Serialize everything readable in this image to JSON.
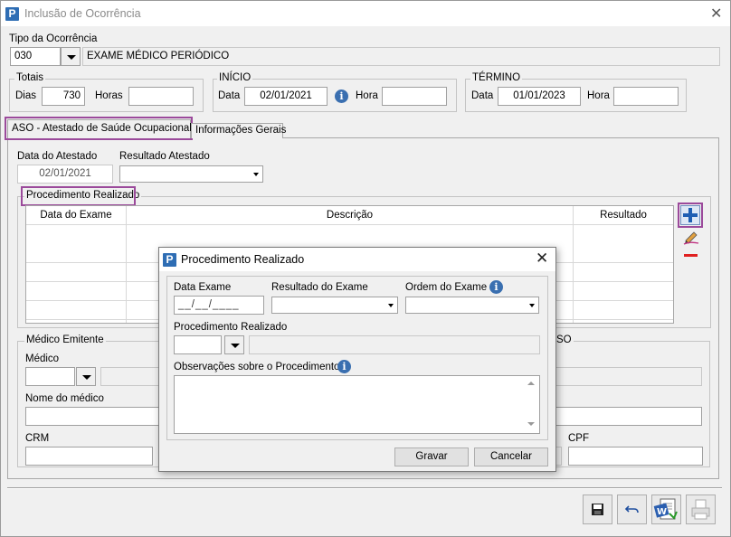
{
  "window": {
    "title": "Inclusão de Ocorrência"
  },
  "tipo": {
    "label": "Tipo da Ocorrência",
    "code": "030",
    "description": "EXAME MÉDICO PERIÓDICO"
  },
  "totais": {
    "title": "Totais",
    "dias_label": "Dias",
    "dias_value": "730",
    "horas_label": "Horas",
    "horas_value": ""
  },
  "inicio": {
    "title": "INÍCIO",
    "data_label": "Data",
    "data_value": "02/01/2021",
    "hora_label": "Hora",
    "hora_value": ""
  },
  "termino": {
    "title": "TÉRMINO",
    "data_label": "Data",
    "data_value": "01/01/2023",
    "hora_label": "Hora",
    "hora_value": ""
  },
  "tabs": [
    {
      "label": "ASO - Atestado de Saúde Ocupacional",
      "active": true
    },
    {
      "label": "Informações Gerais",
      "active": false
    }
  ],
  "aso": {
    "data_atestado_label": "Data do Atestado",
    "data_atestado_value": "02/01/2021",
    "resultado_label": "Resultado Atestado",
    "resultado_value": "",
    "procedimento_group_title": "Procedimento Realizado",
    "grid_headers": [
      "Data do Exame",
      "Descrição",
      "Resultado"
    ],
    "medico_group_title": "Médico Emitente",
    "medico_label": "Médico",
    "nome_medico_label": "Nome do médico",
    "crm_label": "CRM",
    "right_group_title_fragment": "SO",
    "cpf_label": "CPF"
  },
  "dialog": {
    "title": "Procedimento Realizado",
    "data_exame_label": "Data Exame",
    "data_exame_value": "__/__/____",
    "resultado_exame_label": "Resultado do Exame",
    "ordem_exame_label": "Ordem do Exame",
    "procedimento_label": "Procedimento Realizado",
    "observacoes_label": "Observações sobre o Procedimento",
    "save_label": "Gravar",
    "cancel_label": "Cancelar"
  },
  "colors": {
    "accent": "#2e6db4",
    "highlight": "#9b4a9b",
    "remove": "#e02020"
  }
}
